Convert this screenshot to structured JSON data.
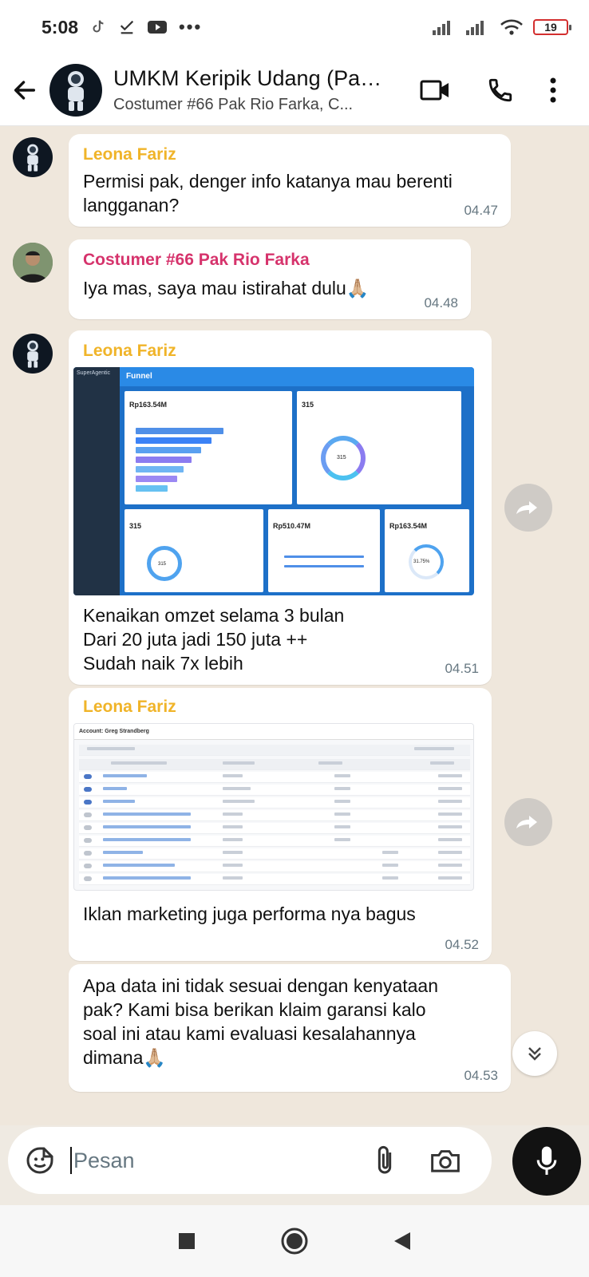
{
  "status_bar": {
    "time": "5:08",
    "battery": "19"
  },
  "header": {
    "title": "UMKM Keripik Udang (Pak...",
    "subtitle": "Costumer #66 Pak Rio Farka, C...",
    "icons": [
      "back-arrow-icon",
      "video-call-icon",
      "phone-icon",
      "more-vert-icon"
    ]
  },
  "messages": [
    {
      "sender": "Leona Fariz",
      "text": "Permisi pak, denger info katanya mau berenti\nlangganan?",
      "time": "04.47"
    },
    {
      "sender": "Costumer #66 Pak Rio Farka",
      "text": "Iya mas, saya mau istirahat dulu🙏🏼",
      "time": "04.48"
    },
    {
      "sender": "Leona Fariz",
      "image": {
        "app": "SuperAgentic",
        "page_title": "Funnel",
        "card_values": [
          "Rp163.54M",
          "315",
          "315",
          "Rp510.47M",
          "Rp163.54M"
        ],
        "ring_labels": [
          "315",
          "315",
          "31.75%"
        ]
      },
      "text": "Kenaikan omzet selama 3 bulan\nDari 20 juta jadi 150 juta ++\nSudah naik 7x lebih",
      "time": "04.51"
    },
    {
      "sender": "Leona Fariz",
      "image": {
        "account": "Account: Greg Strandberg"
      },
      "text": "Iklan marketing juga performa nya bagus",
      "time": "04.52"
    },
    {
      "text": "Apa data ini tidak sesuai dengan kenyataan\npak? Kami bisa berikan klaim garansi kalo\nsoal ini atau kami evaluasi kesalahannya\ndimana🙏🏼",
      "time": "04.53"
    }
  ],
  "input": {
    "placeholder": "Pesan"
  },
  "colors": {
    "sender_primary": "#f0b429",
    "sender_secondary": "#d6336c",
    "chat_bg": "#efe7dc"
  }
}
